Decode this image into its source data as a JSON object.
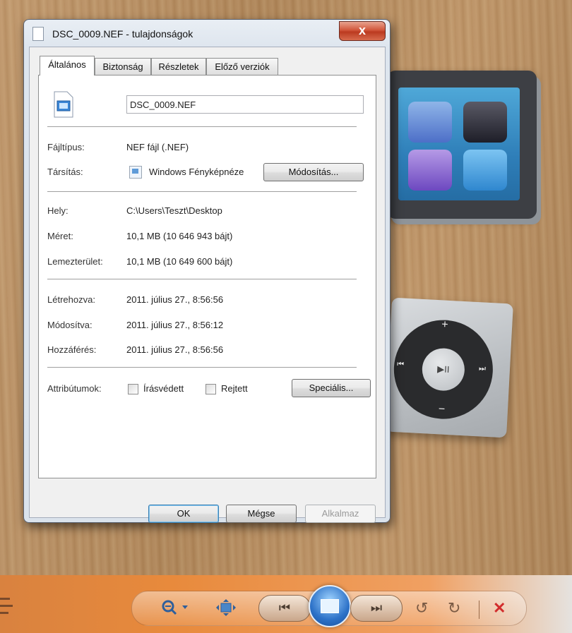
{
  "window": {
    "title": "DSC_0009.NEF - tulajdonságok",
    "close_label": "x"
  },
  "tabs": [
    {
      "label": "Általános",
      "active": true
    },
    {
      "label": "Biztonság",
      "active": false
    },
    {
      "label": "Részletek",
      "active": false
    },
    {
      "label": "Előző verziók",
      "active": false
    }
  ],
  "general": {
    "file_name": "DSC_0009.NEF",
    "file_type_label": "Fájltípus:",
    "file_type_value": "NEF fájl (.NEF)",
    "opens_with_label": "Társítás:",
    "opens_with_value": "Windows Fényképnéze",
    "change_button": "Módosítás...",
    "location_label": "Hely:",
    "location_value": "C:\\Users\\Teszt\\Desktop",
    "size_label": "Méret:",
    "size_value": "10,1 MB (10 646 943 bájt)",
    "size_on_disk_label": "Lemezterület:",
    "size_on_disk_value": "10,1 MB (10 649 600 bájt)",
    "created_label": "Létrehozva:",
    "created_value": "2011. július 27., 8:56:56",
    "modified_label": "Módosítva:",
    "modified_value": "2011. július 27., 8:56:12",
    "accessed_label": "Hozzáférés:",
    "accessed_value": "2011. július 27., 8:56:56",
    "attributes_label": "Attribútumok:",
    "readonly_label": "Írásvédett",
    "readonly_checked": false,
    "hidden_label": "Rejtett",
    "hidden_checked": false,
    "advanced_button": "Speciális..."
  },
  "footer": {
    "ok": "OK",
    "cancel": "Mégse",
    "apply": "Alkalmaz"
  },
  "icons": {
    "file": "image-file-icon",
    "app": "photo-viewer-icon",
    "zoom": "magnifier-icon",
    "fit": "fit-window-icon",
    "prev": "previous-icon",
    "slideshow": "slideshow-icon",
    "next": "next-icon",
    "rotate_left": "rotate-left-icon",
    "rotate_right": "rotate-right-icon",
    "delete": "delete-icon"
  },
  "colors": {
    "close_button": "#c8452b",
    "viewer_bar": "#e88a3c",
    "delete_icon": "#d22c2c"
  }
}
